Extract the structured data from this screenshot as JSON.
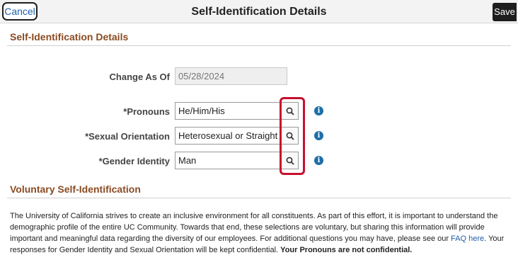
{
  "header": {
    "cancel_label": "Cancel",
    "title": "Self-Identification Details",
    "save_label": "Save"
  },
  "section1": {
    "title": "Self-Identification Details"
  },
  "form": {
    "change_as_of": {
      "label": "Change As Of",
      "value": "05/28/2024"
    },
    "pronouns": {
      "label": "*Pronouns",
      "value": "He/Him/His"
    },
    "sexual_orientation": {
      "label": "*Sexual Orientation",
      "value": "Heterosexual or Straight"
    },
    "gender_identity": {
      "label": "*Gender Identity",
      "value": "Man"
    },
    "lookup_icon": "search-icon",
    "info_icon": "info-icon",
    "info_glyph": "i"
  },
  "section2": {
    "title": "Voluntary Self-Identification",
    "paragraph_start": "The University of California strives to create an inclusive environment for all constituents. As part of this effort, it is important to understand the demographic profile of the entire UC Community. Towards that end, these selections are voluntary, but sharing this information will provide important and meaningful data regarding the diversity of our employees. For additional questions you may have, please see our ",
    "faq_link": "FAQ here",
    "paragraph_middle": ". Your responses for Gender Identity and Sexual Orientation will be kept confidential. ",
    "paragraph_bold": "Your Pronouns are not confidential."
  },
  "colors": {
    "accent": "#8a4b22",
    "link": "#1f5fa8",
    "highlight": "#c8102e",
    "info": "#1e6fa8"
  }
}
